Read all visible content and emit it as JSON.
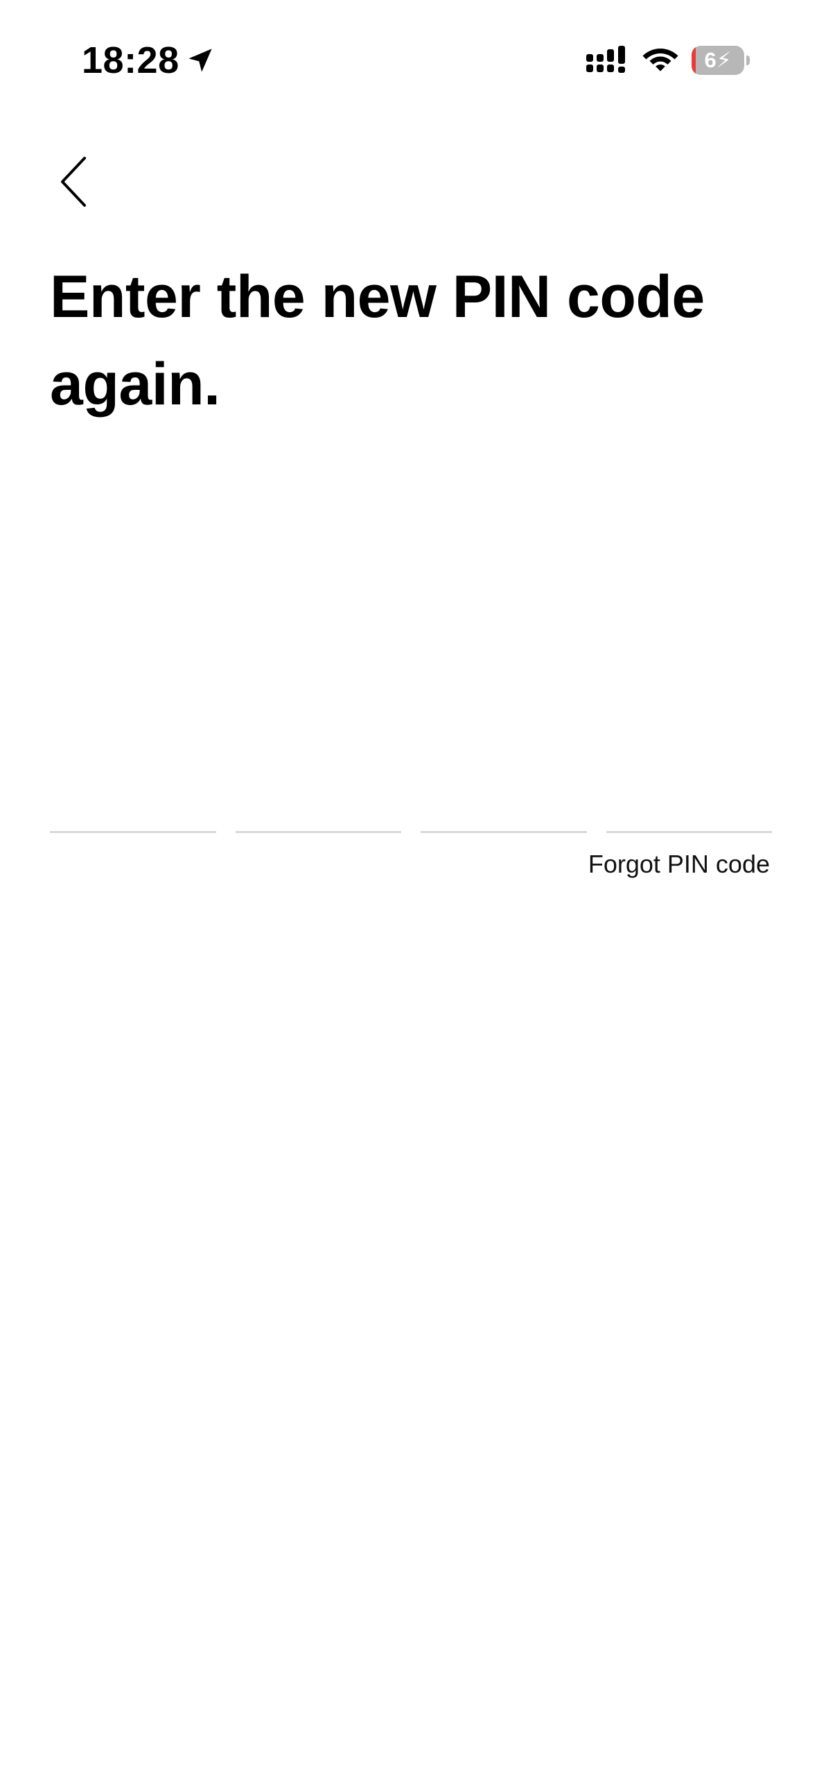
{
  "status_bar": {
    "time": "18:28",
    "battery_level": "6",
    "battery_charging": true,
    "icons": [
      "location-arrow-icon",
      "cellular-signal-icon",
      "wifi-icon",
      "battery-icon"
    ]
  },
  "header": {
    "back_icon": "chevron-left-icon"
  },
  "main": {
    "title": "Enter the new PIN code again.",
    "pin_length": 4,
    "forgot_pin_label": "Forgot PIN code"
  },
  "colors": {
    "background": "#ffffff",
    "text": "#000000",
    "pin_underline": "#d9d9d9",
    "battery_gray": "#b7b7b7",
    "battery_low": "#ea3b3b"
  }
}
